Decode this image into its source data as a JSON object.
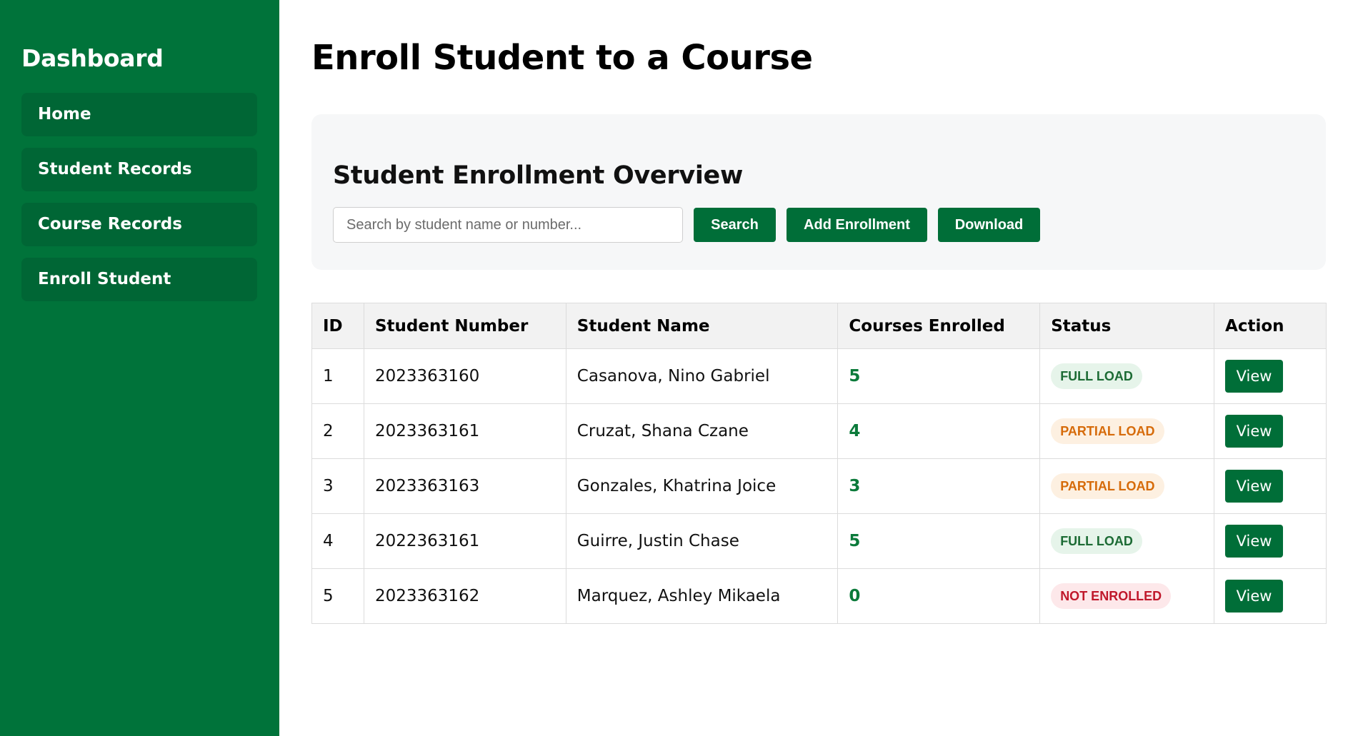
{
  "sidebar": {
    "title": "Dashboard",
    "items": [
      {
        "label": "Home"
      },
      {
        "label": "Student Records"
      },
      {
        "label": "Course Records"
      },
      {
        "label": "Enroll Student"
      }
    ]
  },
  "main": {
    "page_title": "Enroll Student to a Course",
    "panel": {
      "title": "Student Enrollment Overview",
      "search_placeholder": "Search by student name or number...",
      "search_value": "",
      "buttons": {
        "search": "Search",
        "add": "Add Enrollment",
        "download": "Download"
      }
    },
    "table": {
      "headers": [
        "ID",
        "Student Number",
        "Student Name",
        "Courses Enrolled",
        "Status",
        "Action"
      ],
      "rows": [
        {
          "id": "1",
          "number": "2023363160",
          "name": "Casanova, Nino Gabriel",
          "courses": "5",
          "status": "FULL LOAD",
          "action": "View"
        },
        {
          "id": "2",
          "number": "2023363161",
          "name": "Cruzat, Shana Czane",
          "courses": "4",
          "status": "PARTIAL LOAD",
          "action": "View"
        },
        {
          "id": "3",
          "number": "2023363163",
          "name": "Gonzales, Khatrina Joice",
          "courses": "3",
          "status": "PARTIAL LOAD",
          "action": "View"
        },
        {
          "id": "4",
          "number": "2022363161",
          "name": "Guirre, Justin Chase",
          "courses": "5",
          "status": "FULL LOAD",
          "action": "View"
        },
        {
          "id": "5",
          "number": "2023363162",
          "name": "Marquez, Ashley Mikaela",
          "courses": "0",
          "status": "NOT ENROLLED",
          "action": "View"
        }
      ]
    }
  },
  "colors": {
    "sidebar_bg": "#00733a",
    "nav_item_bg": "#006635",
    "button_bg": "#006e38",
    "badge_full": "#1c6b34",
    "badge_partial": "#d66b0a",
    "badge_not_enrolled": "#c0182b"
  }
}
